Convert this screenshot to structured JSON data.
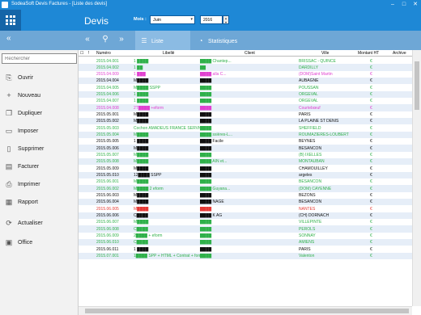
{
  "window": {
    "title": "SodeaSoft Devis Factures - [Liste des devis]",
    "minimize": "–",
    "maximize": "□",
    "close": "✕"
  },
  "header": {
    "app_name": "Devis",
    "month_label": "Mois :",
    "month_value": "Juin",
    "year_value": "2016"
  },
  "sidebar": {
    "collapse": "«",
    "search_placeholder": "Rechercher",
    "items": [
      {
        "label": "Ouvrir",
        "icon": "open-icon"
      },
      {
        "label": "Nouveau",
        "icon": "plus-icon"
      },
      {
        "label": "Dupliquer",
        "icon": "duplicate-icon"
      },
      {
        "label": "Imposer",
        "icon": "impose-icon"
      },
      {
        "label": "Supprimer",
        "icon": "delete-icon"
      },
      {
        "label": "Facturer",
        "icon": "invoice-icon"
      },
      {
        "label": "Imprimer",
        "icon": "print-icon"
      },
      {
        "label": "Rapport",
        "icon": "report-icon"
      },
      {
        "label": "Actualiser",
        "icon": "refresh-icon"
      },
      {
        "label": "Office",
        "icon": "office-icon"
      }
    ]
  },
  "toolbar": {
    "tab_list": "Liste",
    "tab_stats": "Statistiques"
  },
  "table": {
    "columns": [
      "Numéro",
      "Libellé",
      "Client",
      "Ville",
      "Montant HT",
      "Archive"
    ],
    "rows": [
      {
        "num": "2015.04.001",
        "lib": "1 ████",
        "cli": "████ Chantep...",
        "vil": "BRISSAC - QUINCE",
        "mon": "€",
        "color": "green"
      },
      {
        "num": "2015.04.002",
        "lib": "1 ██",
        "cli": "██",
        "vil": "DARDILLY",
        "mon": "€",
        "color": "green"
      },
      {
        "num": "2015.04.009",
        "lib": "1 ███",
        "cli": "████ alla C...",
        "vil": "(DOM)Saint Martin",
        "mon": "€",
        "color": "magenta"
      },
      {
        "num": "2015.04.004",
        "lib": "M████",
        "cli": "████",
        "vil": "AUBAGNE",
        "mon": "€",
        "color": "black"
      },
      {
        "num": "2015.04.005",
        "lib": "M████ SSPP",
        "cli": "████",
        "vil": "POUSSAN",
        "mon": "€",
        "color": "green"
      },
      {
        "num": "2015.04.006",
        "lib": "1 ████",
        "cli": "████",
        "vil": "ORGEVAL",
        "mon": "€",
        "color": "green"
      },
      {
        "num": "2015.04.007",
        "lib": "1 ████",
        "cli": "████",
        "vil": "ORGEVAL",
        "mon": "€",
        "color": "green"
      },
      {
        "num": "2015.04.008",
        "lib": "2T████ +eform",
        "cli": "████",
        "vil": "Courtebœuf",
        "mon": "€",
        "color": "magenta"
      },
      {
        "num": "2015.05.001",
        "lib": "M████",
        "cli": "████",
        "vil": "PARIS",
        "mon": "€",
        "color": "black"
      },
      {
        "num": "2015.05.002",
        "lib": "M████",
        "cli": "████",
        "vil": "LA PLAINE ST DENIS",
        "mon": "€",
        "color": "black"
      },
      {
        "num": "2015.05.003",
        "lib": "Cochon AMADEUS FRANCE SERVICE",
        "cli": "████",
        "vil": "SHEFFIELD",
        "mon": "€",
        "color": "green"
      },
      {
        "num": "2015.05.004",
        "lib": "M████",
        "cli": "████ ssières-L...",
        "vil": "ROUMAZIÈRES-LOUBERT",
        "mon": "€",
        "color": "green"
      },
      {
        "num": "2015.05.005",
        "lib": "1 ████",
        "cli": "████ Facile",
        "vil": "BEYNES",
        "mon": "€",
        "color": "black"
      },
      {
        "num": "2015.05.006",
        "lib": "M████",
        "cli": "████",
        "vil": "BESANCON",
        "mon": "€",
        "color": "black"
      },
      {
        "num": "2015.05.007",
        "lib": "M████",
        "cli": "████",
        "vil": "(B) IXELLES",
        "mon": "€",
        "color": "green"
      },
      {
        "num": "2015.05.008",
        "lib": "M████",
        "cli": "████ AIN et...",
        "vil": "MONTAUBAN",
        "mon": "€",
        "color": "green"
      },
      {
        "num": "2015.05.009",
        "lib": "M████",
        "cli": "████",
        "vil": "CHAMOUILLEY",
        "mon": "€",
        "color": "black"
      },
      {
        "num": "2015.05.010",
        "lib": "12████ SSPP",
        "cli": "████",
        "vil": "argeles",
        "mon": "€",
        "color": "black"
      },
      {
        "num": "2015.06.001",
        "lib": "M████",
        "cli": "████",
        "vil": "BESANCON",
        "mon": "€",
        "color": "green"
      },
      {
        "num": "2015.06.002",
        "lib": "M████ 2 eform",
        "cli": "████ Guyana...",
        "vil": "(DOM) CAYENNE",
        "mon": "€",
        "color": "green"
      },
      {
        "num": "2015.06.003",
        "lib": "M████",
        "cli": "████",
        "vil": "BEZONS",
        "mon": "€",
        "color": "black"
      },
      {
        "num": "2015.06.004",
        "lib": "M████",
        "cli": "████ NAGE",
        "vil": "BESANCON",
        "mon": "€",
        "color": "black"
      },
      {
        "num": "2015.06.005",
        "lib": "M████",
        "cli": "████",
        "vil": "NANTES",
        "mon": "€",
        "color": "red"
      },
      {
        "num": "2015.06.006",
        "lib": "C████",
        "cli": "████ K AG",
        "vil": "(CH) DORNACH",
        "mon": "€",
        "color": "black"
      },
      {
        "num": "2015.06.007",
        "lib": "M████",
        "cli": "████",
        "vil": "VILLEPINTE",
        "mon": "€",
        "color": "green"
      },
      {
        "num": "2015.06.008",
        "lib": "C████",
        "cli": "████",
        "vil": "PEROLS",
        "mon": "€",
        "color": "green"
      },
      {
        "num": "2015.06.009",
        "lib": "2████ + eform",
        "cli": "████",
        "vil": "SONNAY",
        "mon": "€",
        "color": "green"
      },
      {
        "num": "2015.06.010",
        "lib": "C████",
        "cli": "████",
        "vil": "AMIENS",
        "mon": "€",
        "color": "green"
      },
      {
        "num": "2015.06.011",
        "lib": "1 ████",
        "cli": "████",
        "vil": "PARIS",
        "mon": "€",
        "color": "black"
      },
      {
        "num": "2015.07.001",
        "lib": "1████ SPP + HTML + Contrat + form",
        "cli": "████",
        "vil": "Valenton",
        "mon": "€",
        "color": "green"
      }
    ]
  }
}
